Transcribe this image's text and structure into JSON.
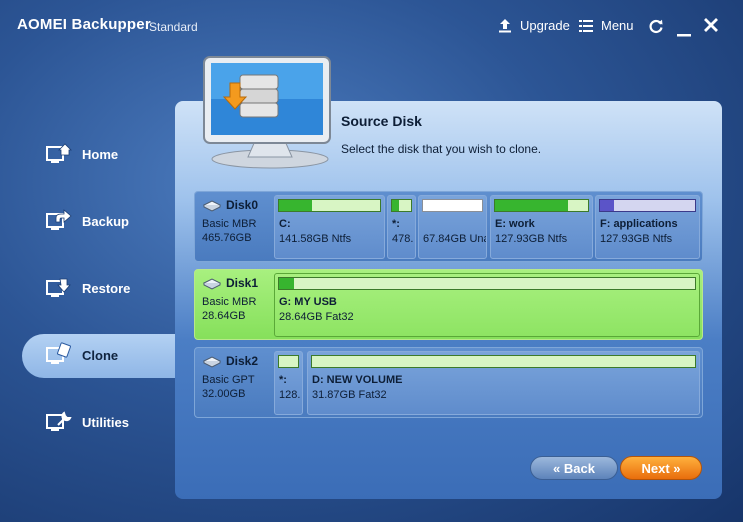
{
  "app": {
    "title": "AOMEI Backupper",
    "edition": "Standard"
  },
  "titlebar": {
    "upgrade_label": "Upgrade",
    "menu_label": "Menu"
  },
  "nav": [
    {
      "label": "Home",
      "icon": "home-icon"
    },
    {
      "label": "Backup",
      "icon": "backup-icon"
    },
    {
      "label": "Restore",
      "icon": "restore-icon"
    },
    {
      "label": "Clone",
      "icon": "clone-icon",
      "active": true
    },
    {
      "label": "Utilities",
      "icon": "utilities-icon"
    }
  ],
  "main": {
    "title": "Source Disk",
    "description": "Select the disk that you wish to clone."
  },
  "disks": [
    {
      "name": "Disk0",
      "type": "Basic MBR",
      "size": "465.76GB",
      "partitions": [
        {
          "name": "C:",
          "size": "141.58GB Ntfs",
          "used_fraction": 0.33,
          "fill_color": "#37b52f"
        },
        {
          "name": "*:",
          "size": "478.",
          "used_fraction": 0.35,
          "fill_color": "#37b52f"
        },
        {
          "name": "",
          "size": "67.84GB Una",
          "used_fraction": 0.0,
          "fill_color": "#ffffff"
        },
        {
          "name": "E: work",
          "size": "127.93GB Ntfs",
          "used_fraction": 0.78,
          "fill_color": "#37b52f"
        },
        {
          "name": "F: applications",
          "size": "127.93GB Ntfs",
          "used_fraction": 0.15,
          "fill_color": "#5b54c8"
        }
      ]
    },
    {
      "name": "Disk1",
      "type": "Basic MBR",
      "size": "28.64GB",
      "selected": true,
      "partitions": [
        {
          "name": "G: MY USB",
          "size": "28.64GB Fat32",
          "used_fraction": 0.035,
          "fill_color": "#37b52f"
        }
      ]
    },
    {
      "name": "Disk2",
      "type": "Basic GPT",
      "size": "32.00GB",
      "partitions": [
        {
          "name": "*:",
          "size": "128.",
          "used_fraction": 0.0,
          "fill_color": "#37b52f"
        },
        {
          "name": "D: NEW VOLUME",
          "size": "31.87GB Fat32",
          "used_fraction": 0.0,
          "fill_color": "#37b52f"
        }
      ]
    }
  ],
  "buttons": {
    "back_label": "Back",
    "next_label": "Next"
  },
  "colors": {
    "accent_next": "#f08a1c",
    "selected_disk": "#8fe864",
    "panel": "#4b7ec5"
  }
}
